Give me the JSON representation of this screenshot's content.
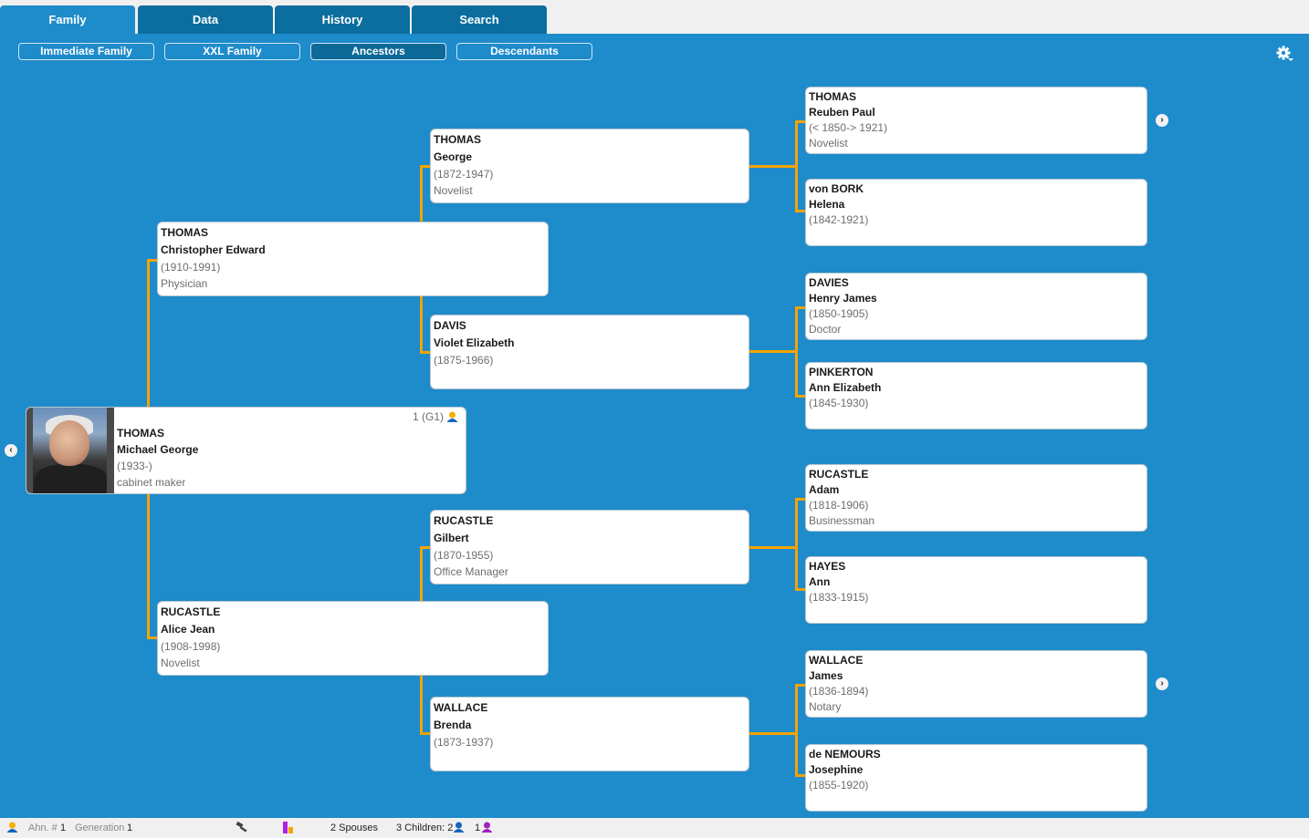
{
  "tabs": [
    {
      "label": "Family",
      "active": true
    },
    {
      "label": "Data",
      "active": false
    },
    {
      "label": "History",
      "active": false
    },
    {
      "label": "Search",
      "active": false
    }
  ],
  "subviews": [
    {
      "label": "Immediate Family",
      "active": false
    },
    {
      "label": "XXL Family",
      "active": false
    },
    {
      "label": "Ancestors",
      "active": true
    },
    {
      "label": "Descendants",
      "active": false
    }
  ],
  "icons": {
    "settings": "gear-icon",
    "nav_back": "chevron-left-icon",
    "nav_forward": "chevron-right-icon"
  },
  "colors": {
    "background": "#1e8bcb",
    "tab_inactive": "#0b6e9e",
    "connector": "#f5a300",
    "male": "#1565c0",
    "female": "#a020c0"
  },
  "root": {
    "surname": "THOMAS",
    "given": "Michael George",
    "dates": "(1933-)",
    "occupation": "cabinet maker",
    "badge": "1 (G1)"
  },
  "parents": [
    {
      "surname": "THOMAS",
      "given": "Christopher Edward",
      "dates": "(1910-1991)",
      "occupation": "Physician"
    },
    {
      "surname": "RUCASTLE",
      "given": "Alice Jean",
      "dates": "(1908-1998)",
      "occupation": "Novelist"
    }
  ],
  "grandparents": [
    {
      "surname": "THOMAS",
      "given": "George",
      "dates": "(1872-1947)",
      "occupation": "Novelist"
    },
    {
      "surname": "DAVIS",
      "given": "Violet Elizabeth",
      "dates": "(1875-1966)",
      "occupation": ""
    },
    {
      "surname": "RUCASTLE",
      "given": "Gilbert",
      "dates": "(1870-1955)",
      "occupation": "Office Manager"
    },
    {
      "surname": "WALLACE",
      "given": "Brenda",
      "dates": "(1873-1937)",
      "occupation": ""
    }
  ],
  "great_grandparents": [
    {
      "surname": "THOMAS",
      "given": "Reuben Paul",
      "dates": "(< 1850-> 1921)",
      "occupation": "Novelist"
    },
    {
      "surname": "von BORK",
      "given": "Helena",
      "dates": "(1842-1921)",
      "occupation": ""
    },
    {
      "surname": "DAVIES",
      "given": "Henry James",
      "dates": "(1850-1905)",
      "occupation": "Doctor"
    },
    {
      "surname": "PINKERTON",
      "given": "Ann Elizabeth",
      "dates": "(1845-1930)",
      "occupation": ""
    },
    {
      "surname": "RUCASTLE",
      "given": "Adam",
      "dates": "(1818-1906)",
      "occupation": "Businessman"
    },
    {
      "surname": "HAYES",
      "given": "Ann",
      "dates": "(1833-1915)",
      "occupation": ""
    },
    {
      "surname": "WALLACE",
      "given": "James",
      "dates": "(1836-1894)",
      "occupation": "Notary"
    },
    {
      "surname": "de NEMOURS",
      "given": "Josephine",
      "dates": "(1855-1920)",
      "occupation": ""
    }
  ],
  "footer": {
    "ahn_label": "Ahn. #",
    "ahn_value": "1",
    "generation_label": "Generation",
    "generation_value": "1",
    "spouses": "2 Spouses",
    "children": "3 Children: 2",
    "daughters": "1"
  }
}
